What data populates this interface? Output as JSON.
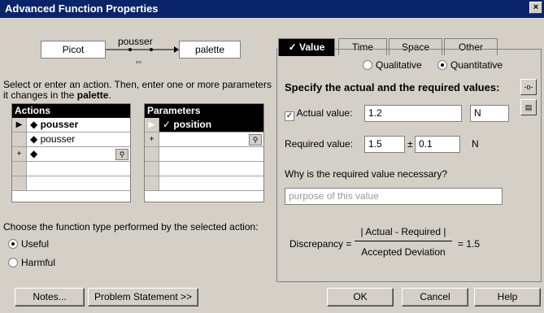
{
  "window": {
    "title": "Advanced Function Properties",
    "close": "×"
  },
  "flow": {
    "subject": "Picot",
    "action": "pousser",
    "object": "palette",
    "swap": "⇔"
  },
  "instructions": {
    "line1": "Select or enter an action. Then, enter one or more parameters",
    "line2a": "it changes in the ",
    "line2b": "palette",
    "line2c": "."
  },
  "actions": {
    "header": "Actions",
    "rows": [
      {
        "marker": "▶",
        "text": "pousser",
        "bold": true
      },
      {
        "marker": "",
        "text": "pousser",
        "bold": false
      },
      {
        "marker": "+",
        "text": "",
        "bold": false
      }
    ]
  },
  "parameters": {
    "header": "Parameters",
    "rows": [
      {
        "marker": "▶",
        "text": "position"
      },
      {
        "marker": "+",
        "text": ""
      }
    ]
  },
  "function_type": {
    "label": "Choose the function type performed by the selected action:",
    "useful": "Useful",
    "harmful": "Harmful"
  },
  "buttons": {
    "notes": "Notes...",
    "problem": "Problem Statement >>",
    "ok": "OK",
    "cancel": "Cancel",
    "help": "Help"
  },
  "tabs": [
    "Value",
    "Time",
    "Space",
    "Other"
  ],
  "value_tab": {
    "qualitative": "Qualitative",
    "quantitative": "Quantitative",
    "heading": "Specify the actual and the required values:",
    "actual_label": "Actual value:",
    "actual_value": "1.2",
    "actual_unit": "N",
    "required_label": "Required value:",
    "required_value": "1.5",
    "pm": "±",
    "deviation": "0.1",
    "required_unit": "N",
    "why_label": "Why is the required value necessary?",
    "why_placeholder": "purpose of this value",
    "discrepancy_label": "Discrepancy =",
    "numerator": "| Actual - Required |",
    "denominator": "Accepted Deviation",
    "result": "= 1.5"
  }
}
